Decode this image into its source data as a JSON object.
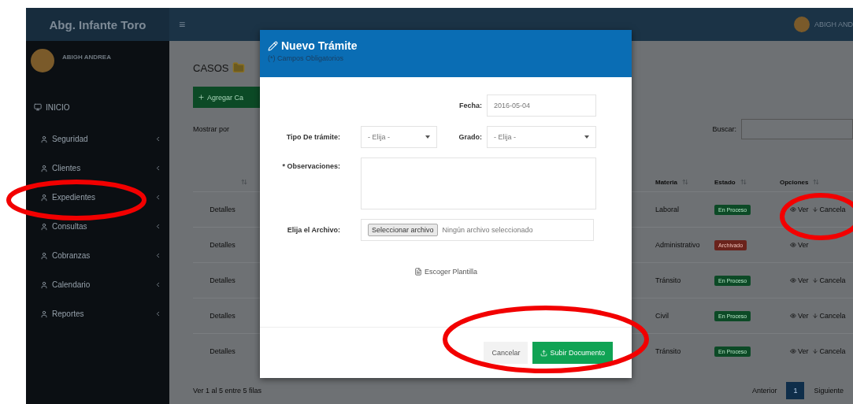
{
  "header": {
    "brand": "Abg. Infante Toro",
    "menu_glyph": "≡",
    "user": "ABIGH AND"
  },
  "sidebar": {
    "user": "ABIGH ANDREA",
    "items": [
      {
        "label": "INICIO",
        "kind": "home",
        "expandable": false
      },
      {
        "label": "Seguridad",
        "kind": "user",
        "expandable": true
      },
      {
        "label": "Clientes",
        "kind": "user",
        "expandable": true
      },
      {
        "label": "Expedientes",
        "kind": "user",
        "expandable": true
      },
      {
        "label": "Consultas",
        "kind": "user",
        "expandable": true
      },
      {
        "label": "Cobranzas",
        "kind": "user",
        "expandable": true
      },
      {
        "label": "Calendario",
        "kind": "user",
        "expandable": true
      },
      {
        "label": "Reportes",
        "kind": "user",
        "expandable": true
      }
    ]
  },
  "content": {
    "title": "CASOS",
    "add_button": "Agregar Ca",
    "show_label": "Mostrar por",
    "search_label": "Buscar:",
    "table": {
      "columns": [
        "Materia",
        "Estado",
        "Opciones"
      ],
      "rows": [
        {
          "detail": "Detalles",
          "materia": "Laboral",
          "estado": {
            "text": "En Proceso",
            "kind": "active"
          },
          "options": [
            {
              "label": "Ver",
              "kind": "view"
            },
            {
              "label": "Cancela",
              "kind": "cancel"
            }
          ]
        },
        {
          "detail": "Detalles",
          "materia": "Administrativo",
          "estado": {
            "text": "Archivado",
            "kind": "archived"
          },
          "options": [
            {
              "label": "Ver",
              "kind": "view"
            }
          ]
        },
        {
          "detail": "Detalles",
          "materia": "Tránsito",
          "estado": {
            "text": "En Proceso",
            "kind": "active"
          },
          "options": [
            {
              "label": "Ver",
              "kind": "view"
            },
            {
              "label": "Cancela",
              "kind": "cancel"
            }
          ]
        },
        {
          "detail": "Detalles",
          "materia": "Civil",
          "estado": {
            "text": "En Proceso",
            "kind": "active"
          },
          "options": [
            {
              "label": "Ver",
              "kind": "view"
            },
            {
              "label": "Cancela",
              "kind": "cancel"
            }
          ]
        },
        {
          "detail": "Detalles",
          "materia": "Tránsito",
          "estado": {
            "text": "En Proceso",
            "kind": "active"
          },
          "options": [
            {
              "label": "Ver",
              "kind": "view"
            },
            {
              "label": "Cancela",
              "kind": "cancel"
            }
          ]
        }
      ]
    },
    "footer": "Ver 1 al 5 entre 5 filas",
    "pagination": [
      {
        "label": "Anterior",
        "selected": false
      },
      {
        "label": "1",
        "selected": true
      },
      {
        "label": "Siguiente",
        "selected": false
      }
    ]
  },
  "modal": {
    "title": "Nuevo Trámite",
    "subtitle": "(*) Campos Obligatorios",
    "fecha_label": "Fecha:",
    "fecha_value": "2016-05-04",
    "tipo_label": "Tipo De trámite:",
    "tipo_value": "- Elija -",
    "grado_label": "Grado:",
    "grado_value": "- Elija -",
    "obs_label": "* Observaciones:",
    "file_label": "Elija el Archivo:",
    "file_button": "Seleccionar archivo",
    "file_status": "Ningún archivo seleccionado",
    "template_link": "Escoger Plantilla",
    "cancel_button": "Cancelar",
    "submit_button": "Subir Documento"
  }
}
